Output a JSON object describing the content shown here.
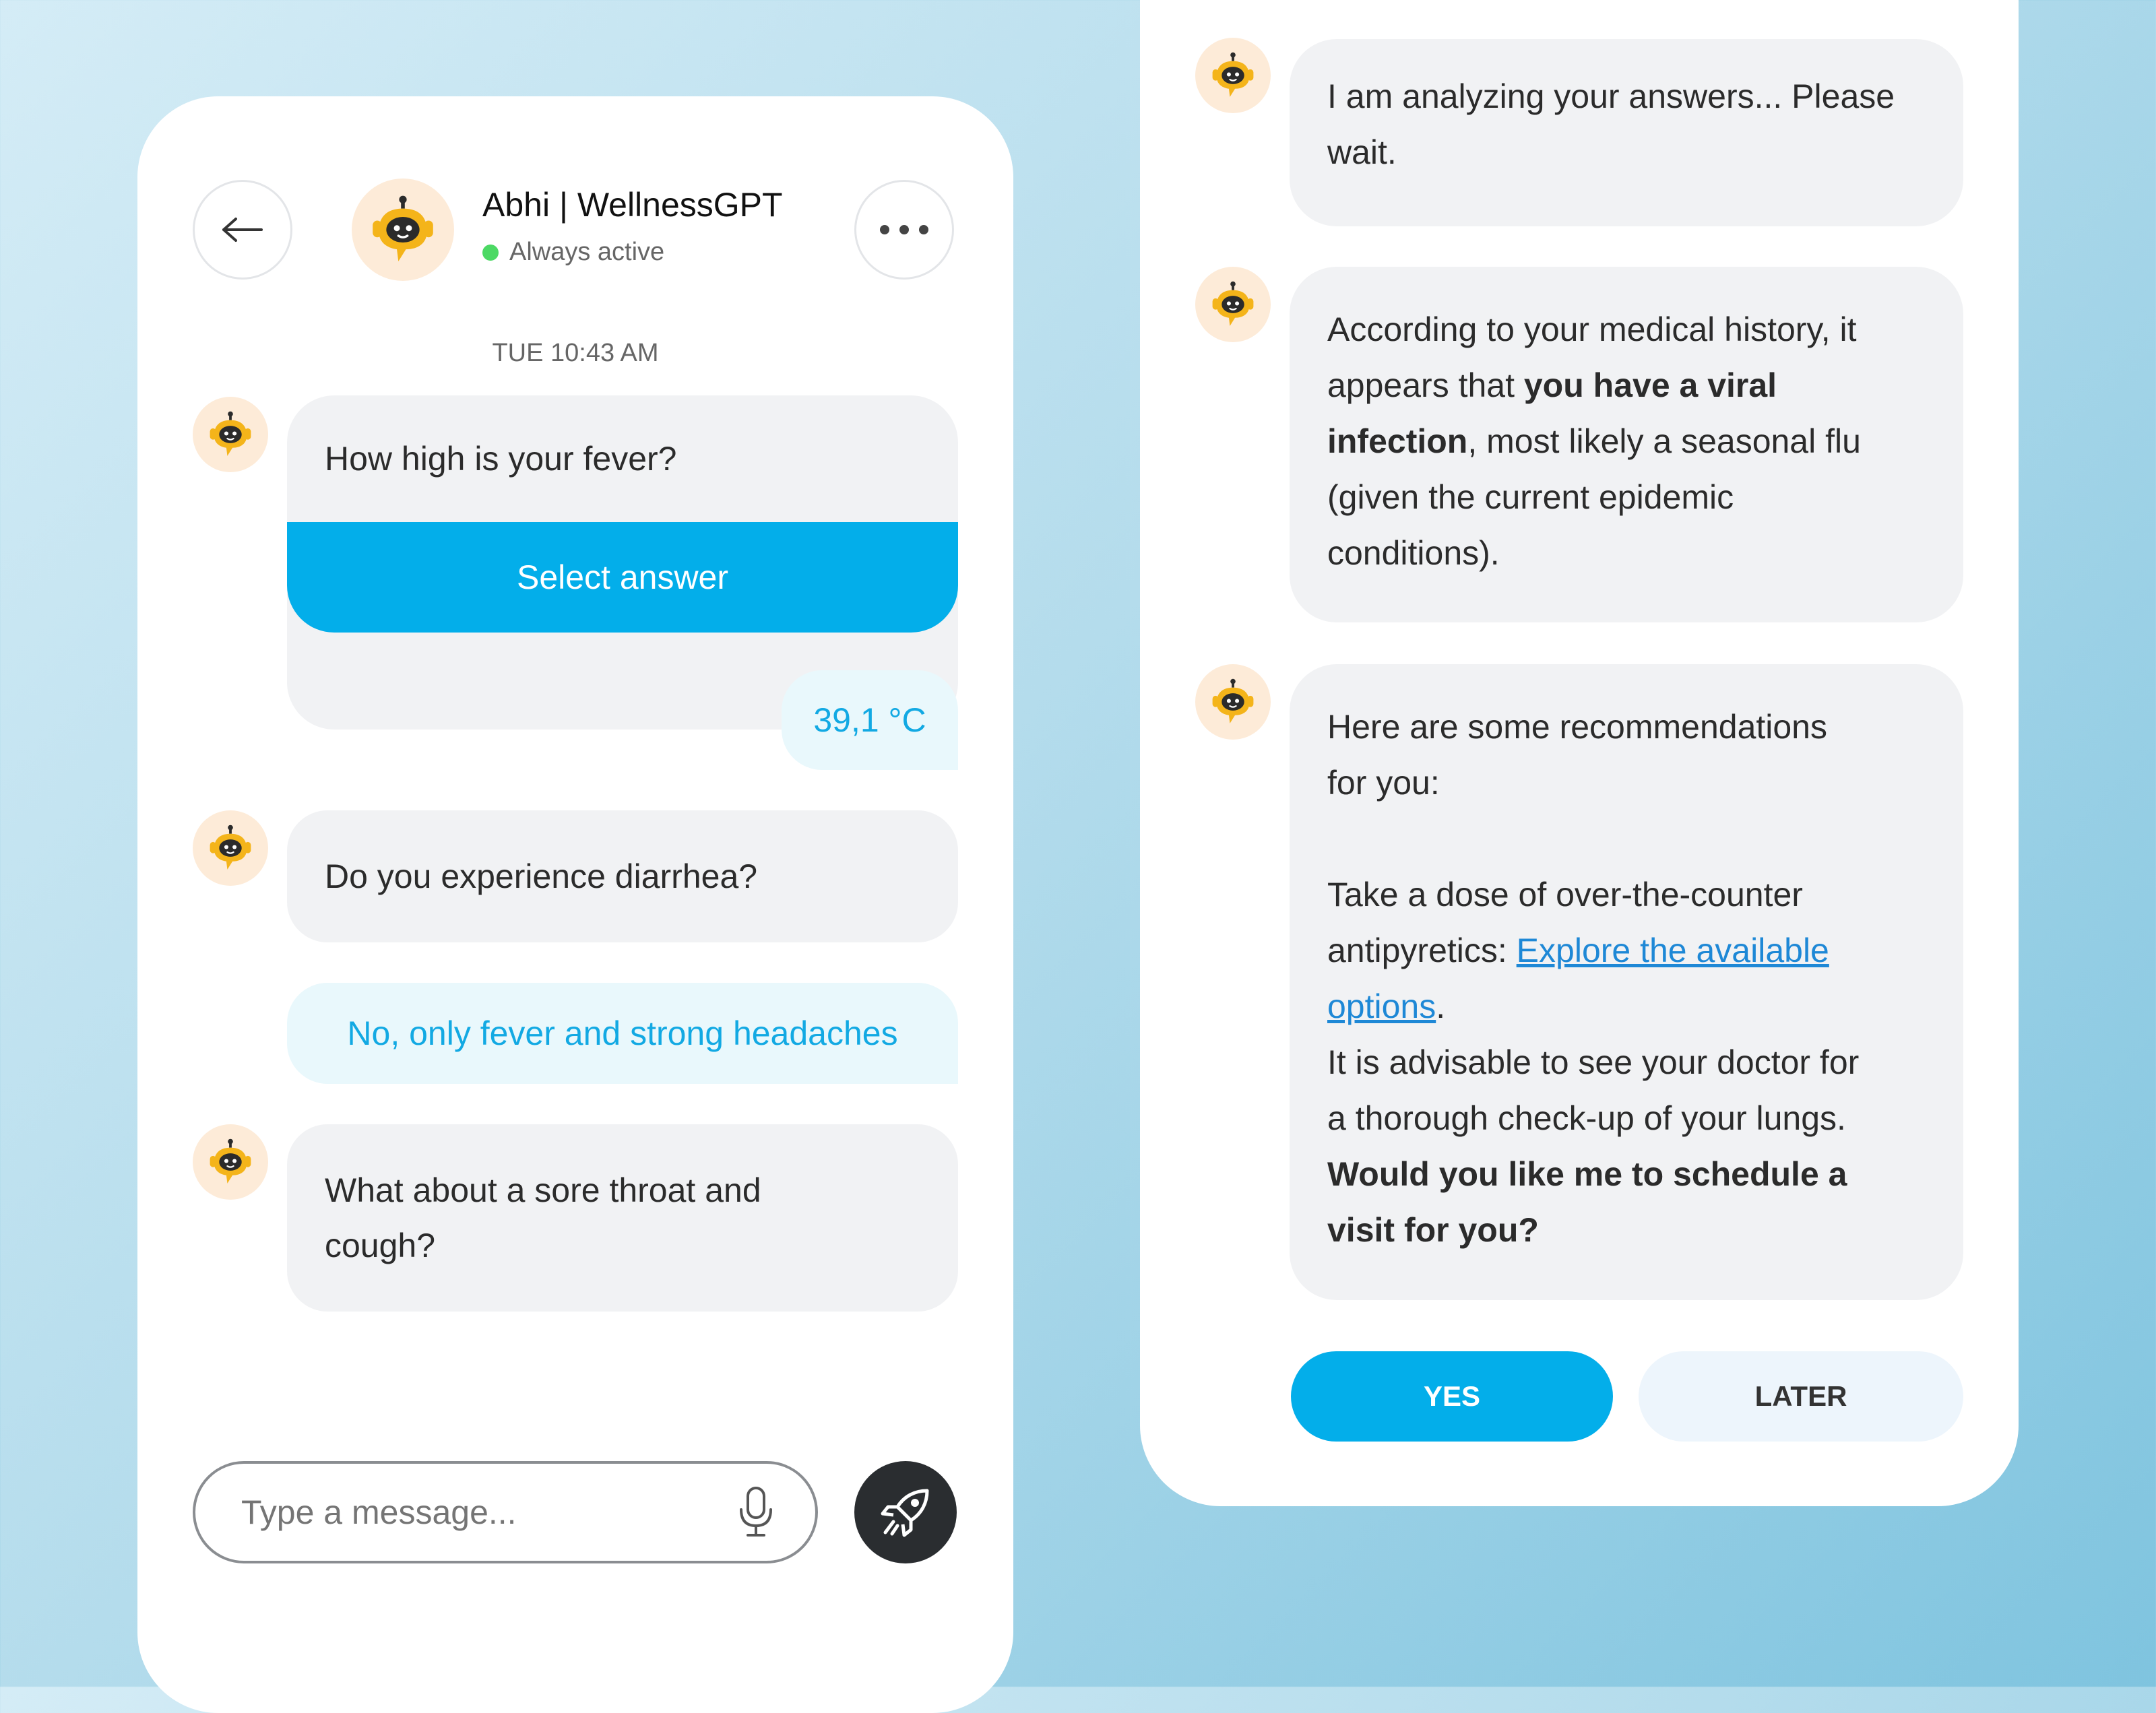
{
  "header": {
    "name": "Abhi | WellnessGPT",
    "status": "Always active",
    "status_color": "#4cd964"
  },
  "chat": {
    "timestamp": "TUE 10:43 AM",
    "q1": "How high is your fever?",
    "select_answer_label": "Select answer",
    "a1": "39,1 °C",
    "q2": "Do you experience diarrhea?",
    "a2": "No, only fever and strong headaches",
    "q3_line1": "What about a sore throat and",
    "q3_line2": "cough?"
  },
  "composer": {
    "placeholder": "Type a message..."
  },
  "right": {
    "m1_line1": "I am analyzing your answers... Please",
    "m1_line2": "wait.",
    "m2": {
      "l1": "According to your medical history, it",
      "l2_pre": "appears that ",
      "l2_bold": "you have a viral",
      "l3_bold": "infection",
      "l3_rest": ", most likely a seasonal flu",
      "l4": "(given the current epidemic",
      "l5": "conditions)."
    },
    "m3": {
      "l1": "Here are some recommendations",
      "l2": "for you:",
      "l3": "Take a dose of over-the-counter",
      "l4_pre": "antipyretics: ",
      "link1": "Explore the available",
      "link2": "options",
      "link_end": ".",
      "l6": "It is advisable to see your doctor for",
      "l7": "a thorough check-up of your lungs.",
      "l8_bold": "Would you like me to schedule a",
      "l9_bold": "visit for you?"
    },
    "yes_label": "YES",
    "later_label": "LATER"
  },
  "colors": {
    "accent": "#03aeea",
    "bot_bubble": "#f1f2f4",
    "user_bubble": "#e9f8fc",
    "send_button": "#2a2d30"
  },
  "icons": [
    "back-arrow-icon",
    "more-dots-icon",
    "bot-icon",
    "microphone-icon",
    "rocket-icon"
  ]
}
